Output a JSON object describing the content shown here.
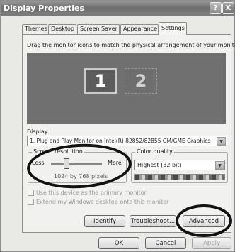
{
  "window": {
    "title": "Display Properties"
  },
  "titlebar_buttons": {
    "help": "?",
    "close": "X"
  },
  "tabs": [
    {
      "label": "Themes"
    },
    {
      "label": "Desktop"
    },
    {
      "label": "Screen Saver"
    },
    {
      "label": "Appearance"
    },
    {
      "label": "Settings"
    }
  ],
  "active_tab": "Settings",
  "instruction": "Drag the monitor icons to match the physical arrangement of your monitors.",
  "monitors": [
    {
      "label": "1"
    },
    {
      "label": "2"
    }
  ],
  "display": {
    "label": "Display:",
    "value": "1. Plug and Play Monitor on Intel(R) 82852/82855 GM/GME Graphics"
  },
  "screen_resolution": {
    "label": "Screen resolution",
    "less": "Less",
    "more": "More",
    "value_text": "1024 by 768 pixels",
    "slider_level": 0.3
  },
  "color_quality": {
    "label": "Color quality",
    "value": "Highest (32 bit)"
  },
  "checkboxes": [
    {
      "label": "Use this device as the primary monitor",
      "checked": false,
      "enabled": false
    },
    {
      "label": "Extend my Windows desktop onto this monitor",
      "checked": false,
      "enabled": false
    }
  ],
  "buttons": {
    "identify": "Identify",
    "troubleshoot": "Troubleshoot...",
    "advanced": "Advanced",
    "ok": "OK",
    "cancel": "Cancel",
    "apply": "Apply"
  },
  "colors": {
    "titlebar": "#7a7a7a",
    "monitor_area": "#707070",
    "annotation": "#121212"
  }
}
